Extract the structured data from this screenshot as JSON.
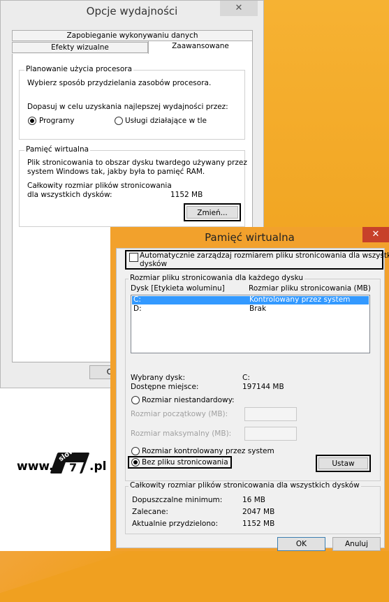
{
  "perf_window": {
    "title": "Opcje wydajności",
    "close_glyph": "✕",
    "tabs": [
      "Zapobieganie wykonywaniu danych",
      "Efekty wizualne",
      "Zaawansowane"
    ],
    "cpu_group": {
      "label": "Planowanie użycia procesora",
      "desc": "Wybierz sposób przydzielania zasobów procesora.",
      "adjust": "Dopasuj w celu uzyskania najlepszej wydajności przez:",
      "option_programs": "Programy",
      "option_services": "Usługi działające w tle",
      "selected": "Programy"
    },
    "vm_group": {
      "label": "Pamięć wirtualna",
      "desc_line1": "Plik stronicowania to obszar dysku twardego używany przez",
      "desc_line2": "system Windows tak, jakby była to pamięć RAM.",
      "total_line1": "Całkowity rozmiar plików stronicowania",
      "total_line2": "dla wszystkich dysków:",
      "total_value": "1152  MB",
      "change_button": "Zmień..."
    },
    "ok_partial": "O"
  },
  "vm_dialog": {
    "title": "Pamięć wirtualna",
    "close_glyph": "✕",
    "auto_manage_line1": "Automatycznie zarządzaj rozmiarem pliku stronicowania dla wszystkich",
    "auto_manage_line2": "dysków",
    "auto_manage_checked": false,
    "per_drive_group": "Rozmiar pliku stronicowania dla każdego dysku",
    "col_drive": "Dysk [Etykieta woluminu]",
    "col_size": "Rozmiar pliku stronicowania (MB)",
    "drives": [
      {
        "drive": "C:",
        "size": "Kontrolowany przez system",
        "selected": true
      },
      {
        "drive": "D:",
        "size": "Brak",
        "selected": false
      }
    ],
    "selected_drive_label": "Wybrany dysk:",
    "selected_drive_value": "C:",
    "free_space_label": "Dostępne miejsce:",
    "free_space_value": "197144  MB",
    "radio_custom": "Rozmiar niestandardowy:",
    "initial_size_label": "Rozmiar początkowy (MB):",
    "max_size_label": "Rozmiar maksymalny (MB):",
    "initial_size_value": "",
    "max_size_value": "",
    "radio_system": "Rozmiar kontrolowany przez system",
    "radio_none": "Bez pliku stronicowania",
    "selected_option": "Bez pliku stronicowania",
    "set_button": "Ustaw",
    "totals_group": "Całkowity rozmiar plików stronicowania dla wszystkich dysków",
    "min_label": "Dopuszczalne minimum:",
    "min_value": "16  MB",
    "recommended_label": "Zalecane:",
    "recommended_value": "2047  MB",
    "allocated_label": "Aktualnie przydzielono:",
    "allocated_value": "1152  MB",
    "ok_button": "OK",
    "cancel_button": "Anuluj"
  },
  "watermark": {
    "prefix": "www.",
    "word": "slow",
    "number": "7",
    "suffix": ".pl"
  },
  "colors": {
    "desktop": "#f0a21e",
    "close_red": "#c7412a",
    "selection": "#3399ff"
  }
}
